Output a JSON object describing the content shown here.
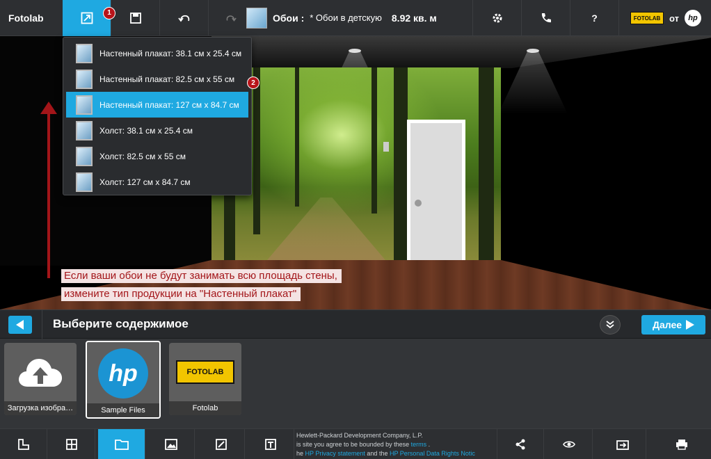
{
  "app": {
    "brand": "Fotolab"
  },
  "toolbar": {
    "badge_1": "1",
    "project_label": "Обои :",
    "project_name": "* Обои в детскую",
    "area": "8.92 кв. м",
    "help_label": "?",
    "brand_from": "от",
    "fotolab_logo_text": "FOTOLAB",
    "hp_logo_text": "hp"
  },
  "dropdown": {
    "badge_2": "2",
    "items": [
      {
        "label": "Настенный плакат: 38.1 см x 25.4 см"
      },
      {
        "label": "Настенный плакат: 82.5 см x 55 см"
      },
      {
        "label": "Настенный плакат: 127 см x 84.7 см"
      },
      {
        "label": "Холст: 38.1 см x 25.4 см"
      },
      {
        "label": "Холст: 82.5 см x 55 см"
      },
      {
        "label": "Холст: 127 см x 84.7 см"
      }
    ],
    "selected_index": 2
  },
  "annotation": {
    "line1": "Если ваши обои не будут занимать всю площадь стены,",
    "line2": "измените тип продукции на \"Настенный плакат\""
  },
  "content": {
    "title": "Выберите содержимое",
    "next_label": "Далее",
    "tiles": [
      {
        "caption": "Загрузка изобра…"
      },
      {
        "caption": "Sample Files",
        "logo": "hp"
      },
      {
        "caption": "Fotolab",
        "logo": "FOTOLAB"
      }
    ]
  },
  "footer": {
    "line1": "Hewlett-Packard Development Company, L.P.",
    "line2_pre": "is site you agree to be bounded by these",
    "line2_link": "terms",
    "line2_post": ".",
    "line3_pre": "he",
    "line3_link1": "HP Privacy statement",
    "line3_mid": "and the",
    "line3_link2": "HP Personal Data Rights Notic"
  },
  "colors": {
    "accent": "#1fa9e1",
    "annotation": "#a31519",
    "toolbar": "#2d2f32"
  }
}
